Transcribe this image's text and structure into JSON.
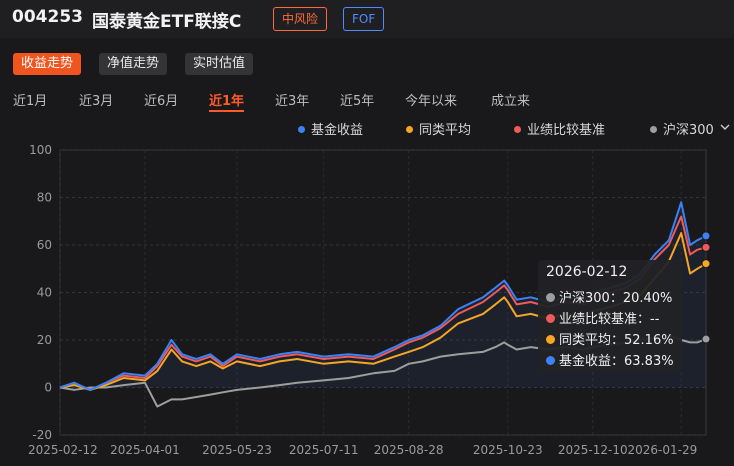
{
  "header": {
    "fund_code": "004253",
    "fund_name": "国泰黄金ETF联接C",
    "risk_badge": "中风险",
    "type_badge": "FOF"
  },
  "sub_tabs": [
    {
      "label": "收益走势",
      "active": true
    },
    {
      "label": "净值走势",
      "active": false
    },
    {
      "label": "实时估值",
      "active": false
    }
  ],
  "ranges": [
    {
      "label": "近1月",
      "active": false
    },
    {
      "label": "近3月",
      "active": false
    },
    {
      "label": "近6月",
      "active": false
    },
    {
      "label": "近1年",
      "active": true
    },
    {
      "label": "近3年",
      "active": false
    },
    {
      "label": "近5年",
      "active": false
    },
    {
      "label": "今年以来",
      "active": false
    },
    {
      "label": "成立来",
      "active": false
    }
  ],
  "legend": {
    "items": [
      {
        "label": "基金收益",
        "color": "#3b82f6"
      },
      {
        "label": "同类平均",
        "color": "#f5a623"
      },
      {
        "label": "业绩比较基准",
        "color": "#ef5a5a"
      },
      {
        "label": "沪深300",
        "color": "#9e9e9e"
      }
    ],
    "dropdown_icon": "chevron-down-icon"
  },
  "tooltip": {
    "date": "2026-02-12",
    "rows": [
      {
        "label": "沪深300：20.40%",
        "color": "#9e9e9e"
      },
      {
        "label": "业绩比较基准：--",
        "color": "#ef5a5a"
      },
      {
        "label": "同类平均：52.16%",
        "color": "#f5a623"
      },
      {
        "label": "基金收益：63.83%",
        "color": "#3b82f6"
      }
    ]
  },
  "chart_data": {
    "type": "line",
    "ylim": [
      -20,
      100
    ],
    "yticks": [
      100,
      80,
      60,
      40,
      20,
      0,
      -20
    ],
    "xticks": [
      "2025-02-12",
      "2025-04-01",
      "2025-05-23",
      "2025-07-11",
      "2025-08-28",
      "2025-10-23",
      "2025-12-10",
      "2026-01-29"
    ],
    "grid": true,
    "legend_position": "top-right",
    "x": [
      "2025-02-12",
      "2025-02-20",
      "2025-03-01",
      "2025-03-10",
      "2025-03-20",
      "2025-04-01",
      "2025-04-08",
      "2025-04-16",
      "2025-04-22",
      "2025-04-30",
      "2025-05-08",
      "2025-05-15",
      "2025-05-23",
      "2025-06-05",
      "2025-06-16",
      "2025-06-26",
      "2025-07-11",
      "2025-07-25",
      "2025-08-08",
      "2025-08-20",
      "2025-08-28",
      "2025-09-05",
      "2025-09-15",
      "2025-09-25",
      "2025-10-09",
      "2025-10-16",
      "2025-10-21",
      "2025-10-23",
      "2025-10-28",
      "2025-11-05",
      "2025-11-15",
      "2025-11-25",
      "2025-12-05",
      "2025-12-10",
      "2025-12-20",
      "2025-12-29",
      "2026-01-06",
      "2026-01-14",
      "2026-01-22",
      "2026-01-29",
      "2026-02-03",
      "2026-02-07",
      "2026-02-12"
    ],
    "series": [
      {
        "name": "基金收益",
        "color": "#3b82f6",
        "values": [
          0,
          2,
          -1,
          2,
          6,
          5,
          10,
          20,
          14,
          12,
          14,
          10,
          14,
          12,
          14,
          15,
          13,
          14,
          13,
          17,
          20,
          22,
          26,
          33,
          38,
          42,
          45,
          43,
          37,
          38,
          36,
          38,
          37,
          40,
          42,
          44,
          48,
          56,
          62,
          78,
          60,
          62,
          63.83
        ]
      },
      {
        "name": "同类平均",
        "color": "#f5a623",
        "values": [
          0,
          1,
          -1,
          1,
          4,
          3,
          7,
          16,
          11,
          9,
          11,
          8,
          11,
          9,
          11,
          12,
          10,
          11,
          10,
          13,
          15,
          17,
          21,
          27,
          31,
          35,
          38,
          36,
          30,
          31,
          29,
          31,
          30,
          32,
          34,
          36,
          39,
          46,
          53,
          65,
          48,
          50,
          52.16
        ]
      },
      {
        "name": "业绩比较基准",
        "color": "#ef5a5a",
        "values": [
          0,
          2,
          -1,
          2,
          5,
          4,
          9,
          18,
          13,
          11,
          13,
          9,
          13,
          11,
          13,
          14,
          12,
          13,
          12,
          16,
          19,
          21,
          25,
          31,
          36,
          40,
          43,
          41,
          35,
          36,
          34,
          36,
          35,
          38,
          40,
          42,
          46,
          54,
          60,
          72,
          56,
          58,
          59
        ]
      },
      {
        "name": "沪深300",
        "color": "#9e9e9e",
        "values": [
          0,
          -1,
          0,
          0,
          1,
          2,
          -8,
          -5,
          -5,
          -4,
          -3,
          -2,
          -1,
          0,
          1,
          2,
          3,
          4,
          6,
          7,
          10,
          11,
          13,
          14,
          15,
          17,
          19,
          18,
          16,
          17,
          16,
          17,
          16,
          17,
          18,
          19,
          20,
          21,
          22,
          20,
          19,
          19,
          20.4
        ]
      }
    ]
  }
}
